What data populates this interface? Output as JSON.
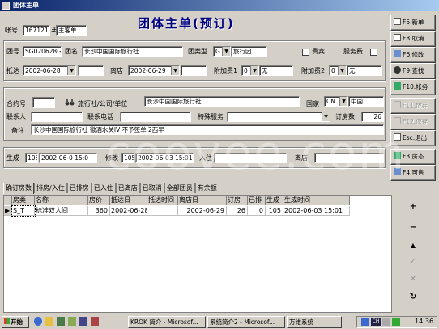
{
  "window": {
    "title": "团体主单"
  },
  "header": {
    "heading": "团体主单(预订)",
    "account_label": "帐号",
    "account_value": "167121",
    "account_suffix": "#",
    "account_type": "主客单"
  },
  "form": {
    "group_no_label": "团号",
    "group_no": "SG020628G",
    "group_name_label": "团名",
    "group_name": "长沙中国国际旅行社",
    "group_type_label": "团类型",
    "group_type_code": "G",
    "group_type_name": "旅行团",
    "vip_label": "贵宾",
    "service_fee_label": "服务费",
    "arrive_label": "抵达",
    "arrive_date": "2002-06-28",
    "depart_label": "离店",
    "depart_date": "2002-06-29",
    "extra1_label": "附加费1",
    "extra1_code": "0",
    "extra1_value": "无",
    "extra2_label": "附加费2",
    "extra2_code": "0",
    "extra2_value": "无",
    "contract_label": "合约号",
    "agency_label": "旅行社/公司/单位",
    "agency_value": "长沙中国国际旅行社",
    "country_label": "国家",
    "country_code": "CN",
    "country_name": "中国",
    "contact_label": "联系人",
    "phone_label": "联系电话",
    "special_label": "特殊服务",
    "rooms_label": "订房数",
    "rooms_value": "26",
    "remark_label": "备注",
    "remark_value": "长沙中国国际旅行社 徽酒水关IV 不予签单 2西早",
    "created_label": "生成",
    "created_user": "105",
    "created_time": "2002-06-0 15:0",
    "modified_label": "修改",
    "modified_user": "105",
    "modified_time": "2002-06-03 15:01",
    "checkin_label": "入住",
    "checkout_label": "离店"
  },
  "buttons": {
    "new": "F5.新单",
    "cancel": "F8.取消",
    "modify": "F6.修改",
    "find": "F9.查找",
    "account": "F10.帐务",
    "done": "F11.放弃",
    "save": "F12.保存",
    "exit": "Esc.退出",
    "room_status": "F3.房态",
    "available": "F4.可售"
  },
  "tabs": [
    "确订房数",
    "排房/入住",
    "已排房",
    "已入住",
    "已离店",
    "已取消",
    "全部团员",
    "有余额"
  ],
  "grid": {
    "columns": [
      "房类",
      "名称",
      "房价",
      "抵达日",
      "抵达时间",
      "离店日",
      "订房",
      "已排",
      "生成",
      "生成时间"
    ],
    "rows": [
      [
        "S_T",
        "标准双人间",
        "360",
        "2002-06-28",
        "",
        "2002-06-29",
        "26",
        "0",
        "105",
        "2002-06-03 15:01"
      ]
    ]
  },
  "nav": [
    "+",
    "−",
    "▲",
    "✓",
    "✕",
    "↻"
  ],
  "watermark": "coovee.com",
  "taskbar": {
    "start": "开始",
    "items": [
      "KROK 简介 - Microsof...",
      "系统简介2 - Microsof...",
      "万维系统"
    ],
    "tray_lang": "CH",
    "clock": "14:36"
  },
  "colors": {
    "title_start": "#0a246a",
    "title_end": "#a6caf0",
    "heading": "#000080",
    "selected_row": "#000000"
  }
}
